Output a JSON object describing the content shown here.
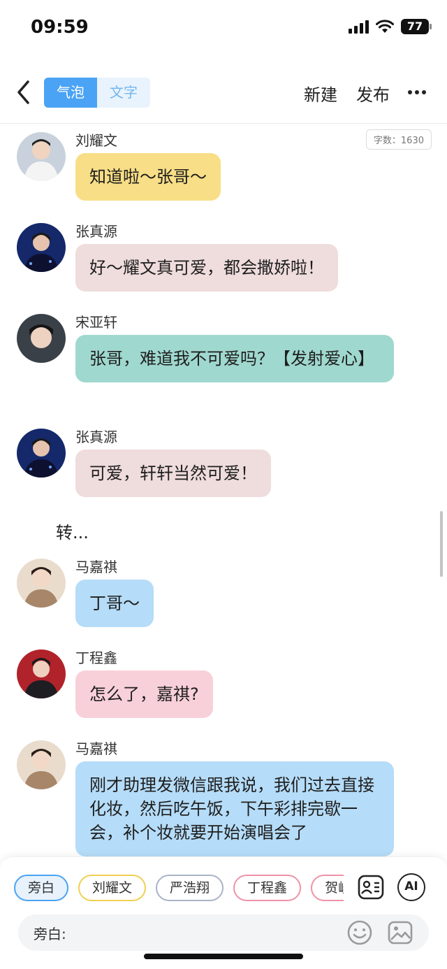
{
  "status_bar": {
    "time": "09:59",
    "battery": "77"
  },
  "nav": {
    "tab_bubble": "气泡",
    "tab_text": "文字",
    "new_label": "新建",
    "publish_label": "发布"
  },
  "chat": {
    "word_count": "字数：1630",
    "messages": [
      {
        "sender": "刘耀文",
        "text": "知道啦～张哥～",
        "bubble_color": "#f8de86"
      },
      {
        "sender": "张真源",
        "text": "好～耀文真可爱，都会撒娇啦！",
        "bubble_color": "#efdcdc"
      },
      {
        "sender": "宋亚轩",
        "text": "张哥，难道我不可爱吗？【发射爱心】",
        "bubble_color": "#9fd8cf"
      },
      {
        "sender": "张真源",
        "text": "可爱，轩轩当然可爱！",
        "bubble_color": "#efdcdc"
      },
      {
        "sender": "马嘉祺",
        "text": "丁哥～",
        "bubble_color": "#b5dcf8"
      },
      {
        "sender": "丁程鑫",
        "text": "怎么了，嘉祺?",
        "bubble_color": "#f8d0da"
      },
      {
        "sender": "马嘉祺",
        "text": "刚才助理发微信跟我说，我们过去直接化妆，然后吃午饭，下午彩排完歇一会，补个妆就要开始演唱会了",
        "bubble_color": "#b5dcf8"
      }
    ],
    "narration": "转..."
  },
  "bottom": {
    "chips": [
      {
        "label": "旁白",
        "color": "#4aa3f4"
      },
      {
        "label": "刘耀文",
        "color": "#f1cf52"
      },
      {
        "label": "严浩翔",
        "color": "#a9b3c6"
      },
      {
        "label": "丁程鑫",
        "color": "#ee93a8"
      },
      {
        "label": "贺峻",
        "color": "#ee93a8"
      }
    ],
    "input_label": "旁白:",
    "ai_label": "AI"
  }
}
